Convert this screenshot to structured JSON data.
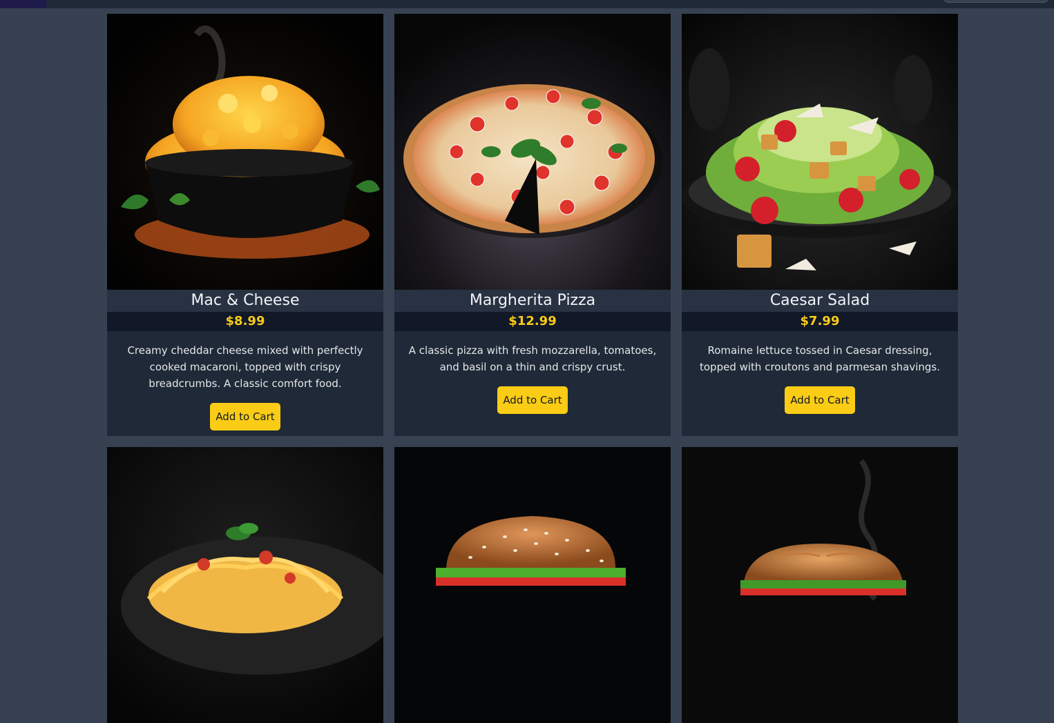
{
  "menu": {
    "items": [
      {
        "name": "Mac & Cheese",
        "price": "$8.99",
        "description": "Creamy cheddar cheese mixed with perfectly cooked macaroni, topped with crispy breadcrumbs. A classic comfort food.",
        "button_label": "Add to Cart",
        "photo": "mac-and-cheese-photo"
      },
      {
        "name": "Margherita Pizza",
        "price": "$12.99",
        "description": "A classic pizza with fresh mozzarella, tomatoes, and basil on a thin and crispy crust.",
        "button_label": "Add to Cart",
        "photo": "pizza-photo"
      },
      {
        "name": "Caesar Salad",
        "price": "$7.99",
        "description": "Romaine lettuce tossed in Caesar dressing, topped with croutons and parmesan shavings.",
        "button_label": "Add to Cart",
        "photo": "salad-photo"
      },
      {
        "photo": "spaghetti-photo"
      },
      {
        "photo": "burger-photo"
      },
      {
        "photo": "sandwich-photo"
      }
    ]
  },
  "colors": {
    "page_bg": "#374151",
    "card_bg": "#1f2937",
    "price": "#facc15",
    "button": "#facc15"
  }
}
